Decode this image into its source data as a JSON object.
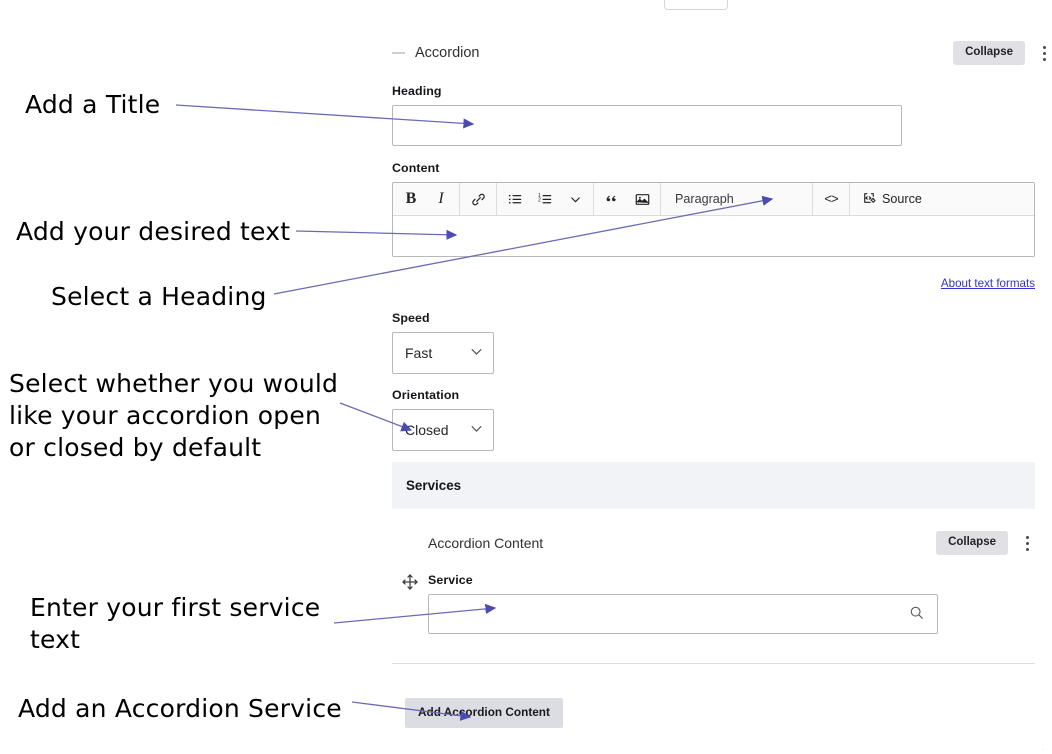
{
  "annotations": [
    {
      "id": "add-a-title",
      "text": "Add a Title"
    },
    {
      "id": "add-desired-text",
      "text": "Add your desired text"
    },
    {
      "id": "select-a-heading",
      "text": "Select a Heading"
    },
    {
      "id": "select-orientation",
      "text": "Select whether you would\nlike your accordion open\nor closed by default"
    },
    {
      "id": "enter-first-service",
      "text": "Enter your first service\ntext"
    },
    {
      "id": "add-accordion-service",
      "text": "Add an Accordion Service"
    }
  ],
  "accordion": {
    "title": "Accordion",
    "collapse_label": "Collapse",
    "menu_icon": "kebab-menu-icon",
    "toggle_icon": "minus-icon"
  },
  "fields": {
    "heading": {
      "label": "Heading",
      "value": "",
      "placeholder": ""
    },
    "content": {
      "label": "Content",
      "value": "",
      "about_link": "About text formats",
      "toolbar": {
        "bold": "B",
        "italic": "I",
        "link_icon": "link-icon",
        "bulleted_list_icon": "bulleted-list-icon",
        "numbered_list_icon": "numbered-list-icon",
        "list-chevron_icon": "chevron-down-icon",
        "blockquote": "“",
        "image_icon": "image-icon",
        "paragraph_label": "Paragraph",
        "paragraph_chevron_icon": "chevron-down-icon",
        "code_label": "<>",
        "source_label": "Source",
        "source_icon": "source-code-edit-icon"
      }
    },
    "speed": {
      "label": "Speed",
      "value": "Fast",
      "chevron_icon": "chevron-down-icon"
    },
    "orientation": {
      "label": "Orientation",
      "value": "Closed",
      "chevron_icon": "chevron-down-icon"
    }
  },
  "services": {
    "band_title": "Services",
    "item": {
      "title": "Accordion Content",
      "collapse_label": "Collapse",
      "menu_icon": "kebab-menu-icon",
      "drag_icon": "move-drag-handle-icon",
      "service_label": "Service",
      "service_value": "",
      "service_search_icon": "search-icon"
    },
    "add_button_label": "Add Accordion Content"
  },
  "colors": {
    "annotation_arrow": "#5c5ca8",
    "link": "#3333cc",
    "button_bg": "#dcdce3",
    "band_bg": "#f2f3f7"
  }
}
